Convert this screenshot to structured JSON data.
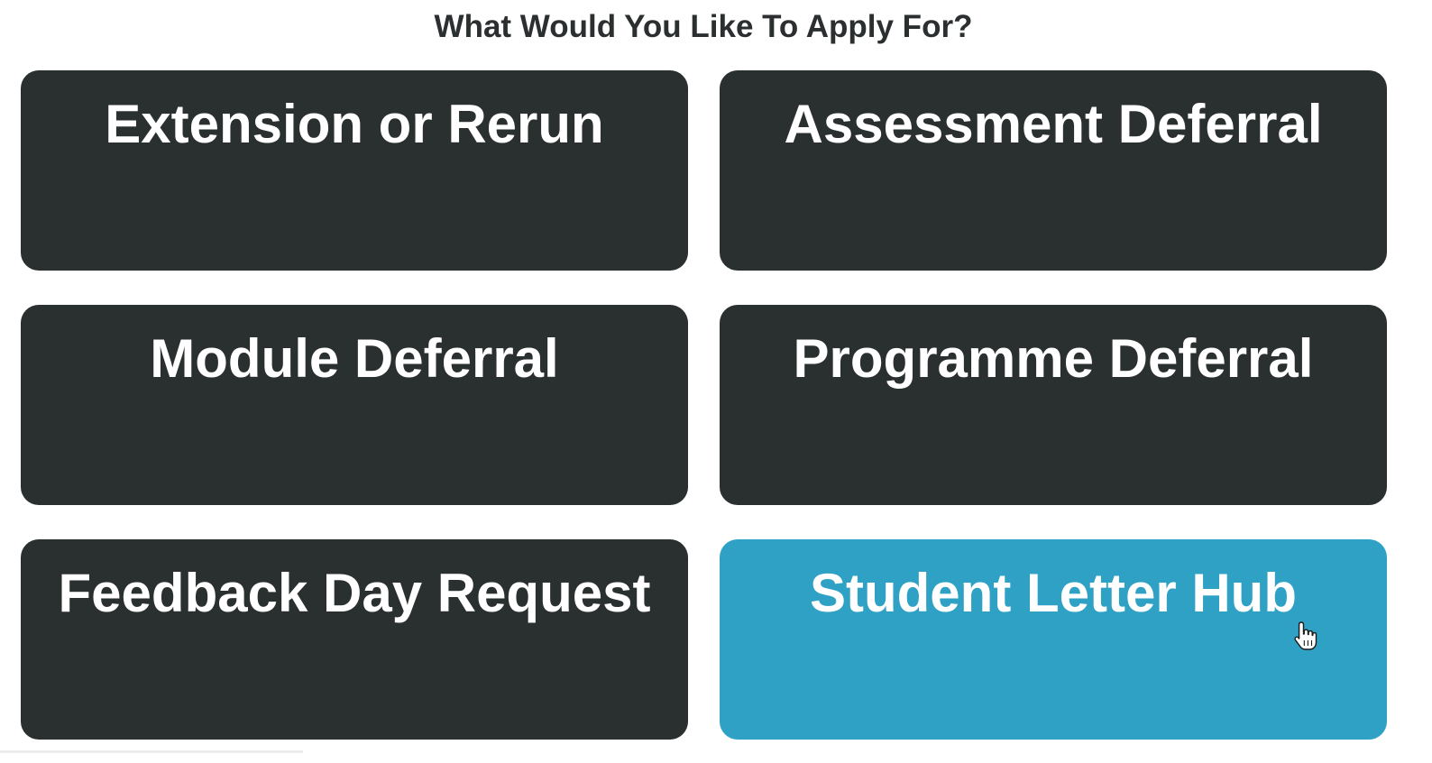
{
  "header": {
    "title": "What Would You Like To Apply For?"
  },
  "options": [
    {
      "label": "Extension or Rerun"
    },
    {
      "label": "Assessment Deferral"
    },
    {
      "label": "Module Deferral"
    },
    {
      "label": "Programme Deferral"
    },
    {
      "label": "Feedback Day Request"
    },
    {
      "label": "Student Letter Hub"
    }
  ],
  "colors": {
    "tile": "#2a2f30",
    "tile_hover": "#2fa1c4",
    "tile_text": "#ffffff",
    "title_text": "#2b2f30"
  },
  "icons": {
    "cursor": "hand-pointer-icon"
  }
}
